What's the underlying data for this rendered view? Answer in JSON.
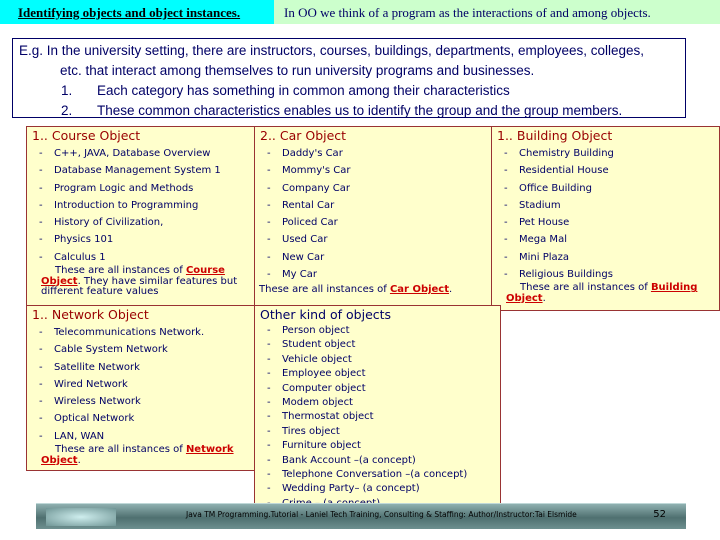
{
  "header": {
    "title": "Identifying objects and object instances.",
    "subtitle": "In OO we think of a program as the interactions of and among objects."
  },
  "intro": {
    "line1": "E.g.  In the university setting, there are instructors, courses, buildings, departments, employees, colleges,",
    "line2": "etc. that interact among themselves to run university programs and businesses.",
    "points": [
      {
        "n": "1.",
        "text": "Each category has something in common among their characteristics"
      },
      {
        "n": "2.",
        "text": "These common characteristics enables us to identify the group and the group members."
      }
    ]
  },
  "course": {
    "title": "1.. Course Object",
    "items": [
      "C++, JAVA, Database Overview",
      "Database Management System 1",
      "Program Logic and Methods",
      "Introduction to Programming",
      "History of Civilization,",
      "Physics 101",
      "Calculus 1"
    ],
    "note_pre": "These are all instances of ",
    "note_link": "Course Object",
    "note_post": ". They have similar features but different feature values"
  },
  "car": {
    "title": "2.. Car Object",
    "items": [
      "Daddy's Car",
      "Mommy's Car",
      "Company Car",
      "Rental Car",
      "Policed Car",
      "Used Car",
      "New Car",
      "My Car"
    ],
    "note_pre": "These are all instances of ",
    "note_link": "Car Object",
    "note_post": "."
  },
  "building": {
    "title": "1.. Building Object",
    "items": [
      "Chemistry Building",
      "Residential House",
      "Office Building",
      "Stadium",
      "Pet House",
      "Mega Mal",
      "Mini Plaza",
      "Religious Buildings"
    ],
    "note_pre": "These are all instances of ",
    "note_link": "Building Object",
    "note_post": "."
  },
  "network": {
    "title": "1.. Network Object",
    "items": [
      "Telecommunications Network.",
      "Cable System Network",
      "Satellite Network",
      "Wired Network",
      "Wireless Network",
      "Optical Network",
      "LAN, WAN"
    ],
    "note_pre": "These are all instances of ",
    "note_link": "Network Object",
    "note_post": "."
  },
  "other": {
    "title": "Other kind of objects",
    "items": [
      "Person object",
      "Student object",
      "Vehicle object",
      "Employee object",
      "Computer object",
      "Modem object",
      "Thermostat object",
      "Tires object",
      "Furniture object",
      "Bank Account –(a concept)",
      "Telephone Conversation –(a concept)",
      "Wedding Party– (a concept)",
      "Crime – (a concept)"
    ]
  },
  "footer": {
    "text": "Java TM Programming.Tutorial - Laniel Tech Training, Consulting & Staffing: Author/Instructor:Tai Elsmide",
    "page": "52"
  }
}
